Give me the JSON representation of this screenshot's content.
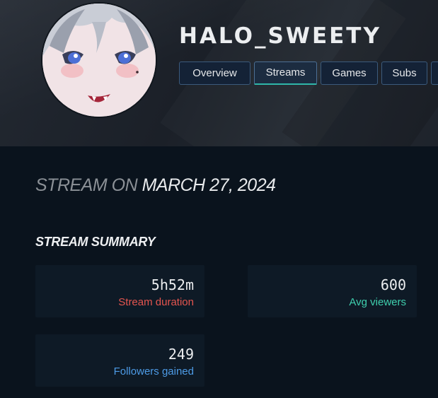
{
  "channel": {
    "username": "HALO_SWEETY"
  },
  "tabs": [
    {
      "label": "Overview",
      "active": false
    },
    {
      "label": "Streams",
      "active": true
    },
    {
      "label": "Games",
      "active": false
    },
    {
      "label": "Subs",
      "active": false
    }
  ],
  "stream": {
    "title_prefix": "STREAM ON",
    "date": "MARCH 27, 2024"
  },
  "summary": {
    "heading": "STREAM SUMMARY",
    "stats": [
      {
        "value": "5h52m",
        "label": "Stream duration",
        "color": "#e5554f"
      },
      {
        "value": "600",
        "label": "Avg viewers",
        "color": "#3fcfae"
      },
      {
        "value": "249",
        "label": "Followers gained",
        "color": "#4d9be6"
      }
    ]
  },
  "colors": {
    "tab_active_accent": "#2fb6a9",
    "tab_border": "#3b5a7c"
  }
}
